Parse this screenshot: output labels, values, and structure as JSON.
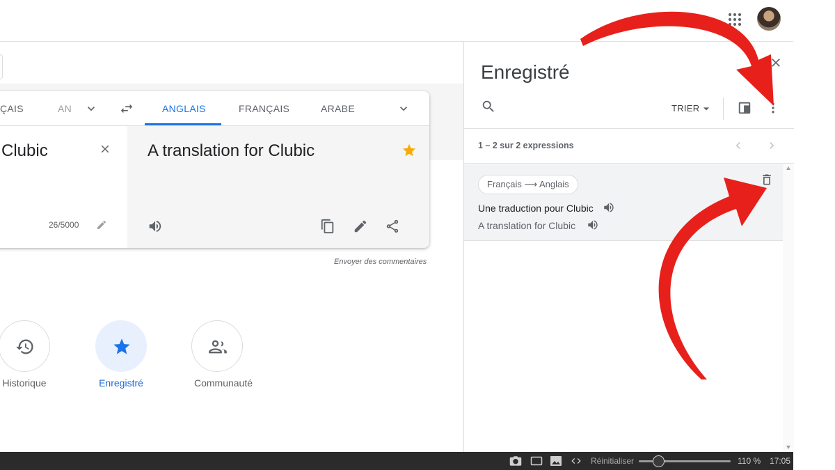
{
  "translator": {
    "source_tabs": [
      "ÇAIS",
      "AN"
    ],
    "target_tabs": [
      "ANGLAIS",
      "FRANÇAIS",
      "ARABE"
    ],
    "source_text": "Clubic",
    "char_count": "26/5000",
    "translated_text": "A translation for Clubic",
    "feedback_link": "Envoyer des commentaires"
  },
  "shortcuts": [
    {
      "label": "Historique",
      "icon": "history-icon"
    },
    {
      "label": "Enregistré",
      "icon": "star-icon"
    },
    {
      "label": "Communauté",
      "icon": "people-icon"
    }
  ],
  "saved_panel": {
    "title": "Enregistré",
    "sort_label": "TRIER",
    "count_text": "1 – 2 sur 2 expressions",
    "entries": [
      {
        "lang_chip": "Français ⟶ Anglais",
        "source": "Une traduction pour Clubic",
        "target": "A translation for Clubic"
      }
    ]
  },
  "taskbar": {
    "reset_label": "Réinitialiser",
    "zoom": "110 %",
    "time": "17:05"
  },
  "colors": {
    "accent": "#1a73e8",
    "star": "#f9ab00",
    "annotation_arrow": "#e8201b",
    "taskbar": "#2b2b2b"
  }
}
